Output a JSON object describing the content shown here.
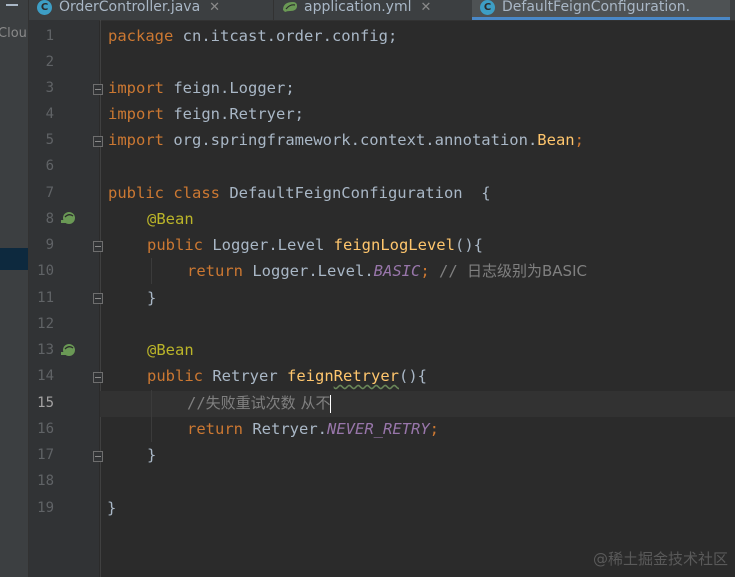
{
  "tabs": [
    {
      "label": "OrderController.java",
      "type": "java",
      "icon": "java-class-icon",
      "active": false
    },
    {
      "label": "application.yml",
      "type": "yml",
      "icon": "spring-yml-icon",
      "active": false
    },
    {
      "label": "DefaultFeignConfiguration.",
      "type": "java",
      "icon": "java-class-icon",
      "active": true
    }
  ],
  "sidebar": {
    "label": "Clou"
  },
  "gutter": {
    "line_numbers": [
      "1",
      "2",
      "3",
      "4",
      "5",
      "6",
      "7",
      "8",
      "9",
      "10",
      "11",
      "12",
      "13",
      "14",
      "15",
      "16",
      "17",
      "18",
      "19"
    ],
    "current_line": "15"
  },
  "code": {
    "l1_kw": "package",
    "l1_rest": " cn.itcast.order.config;",
    "l3_kw": "import",
    "l3_rest": " feign.Logger;",
    "l4_kw": "import",
    "l4_rest": " feign.Retryer;",
    "l5_kw": "import",
    "l5_rest": " org.springframework.context.annotation.",
    "l5_cls": "Bean",
    "l5_end": ";",
    "l7_kw": "public class",
    "l7_rest": " DefaultFeignConfiguration  {",
    "l8_ann": "@Bean",
    "l9_kw": "public",
    "l9_type": " Logger.Level ",
    "l9_fn": "feignLogLevel",
    "l9_end": "(){",
    "l10_kw": "return",
    "l10_type": " Logger.Level.",
    "l10_const": "BASIC",
    "l10_semi": ";",
    "l10_cmt": " // ",
    "l10_cmt_cn": "日志级别为BASIC",
    "l11": "}",
    "l13_ann": "@Bean",
    "l14_kw": "public",
    "l14_type": " Retryer ",
    "l14_fn_a": "feign",
    "l14_fn_b": "Retryer",
    "l14_end": "(){",
    "l15_cmt": "//",
    "l15_cmt_cn": "失败重试次数 从不",
    "l16_kw": "return",
    "l16_type": " Retryer.",
    "l16_const": "NEVER_RETRY",
    "l16_semi": ";",
    "l17": "}",
    "l19": "}"
  },
  "watermark": "@稀土掘金技术社区",
  "colors": {
    "background": "#2b2b2b",
    "gutter": "#313335",
    "keyword": "#cc7832",
    "annotation": "#bbb529",
    "function": "#ffc66d",
    "constant": "#9876aa",
    "comment": "#808080",
    "text": "#a9b7c6",
    "tab_accent": "#4a88c7"
  }
}
